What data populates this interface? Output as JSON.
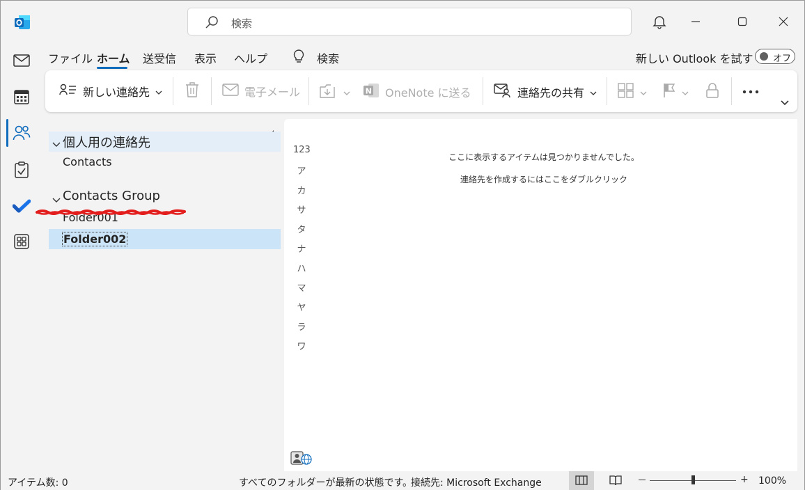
{
  "search": {
    "placeholder": "検索"
  },
  "rail": {
    "items": [
      "mail-icon",
      "calendar-icon",
      "people-icon",
      "tasks-icon",
      "todo-icon",
      "apps-icon"
    ]
  },
  "menu": {
    "tabs": [
      "ファイル",
      "ホーム",
      "送受信",
      "表示",
      "ヘルプ"
    ],
    "search_label": "検索",
    "try_new": "新しい Outlook を試す",
    "toggle_label": "オフ"
  },
  "ribbon": {
    "new_contact": "新しい連絡先",
    "email": "電子メール",
    "onenote": "OneNote に送る",
    "share": "連絡先の共有"
  },
  "folders": {
    "group1": "個人用の連絡先",
    "group1_items": [
      "Contacts"
    ],
    "group2": "Contacts Group",
    "group2_items": [
      "Folder001",
      "Folder002"
    ]
  },
  "index": [
    "123",
    "ア",
    "カ",
    "サ",
    "タ",
    "ナ",
    "ハ",
    "マ",
    "ヤ",
    "ラ",
    "ワ"
  ],
  "content": {
    "empty_msg": "ここに表示するアイテムは見つかりませんでした。",
    "hint_msg": "連絡先を作成するにはここをダブルクリック"
  },
  "status": {
    "items": "アイテム数: 0",
    "sync": "すべてのフォルダーが最新の状態です。",
    "connection": "接続先: Microsoft Exchange",
    "zoom": "100%"
  },
  "colors": {
    "accent": "#0f6cbd",
    "selected_row": "#cce4f7",
    "group_row": "#e3eef9",
    "annotation_red": "#e31c1c"
  }
}
